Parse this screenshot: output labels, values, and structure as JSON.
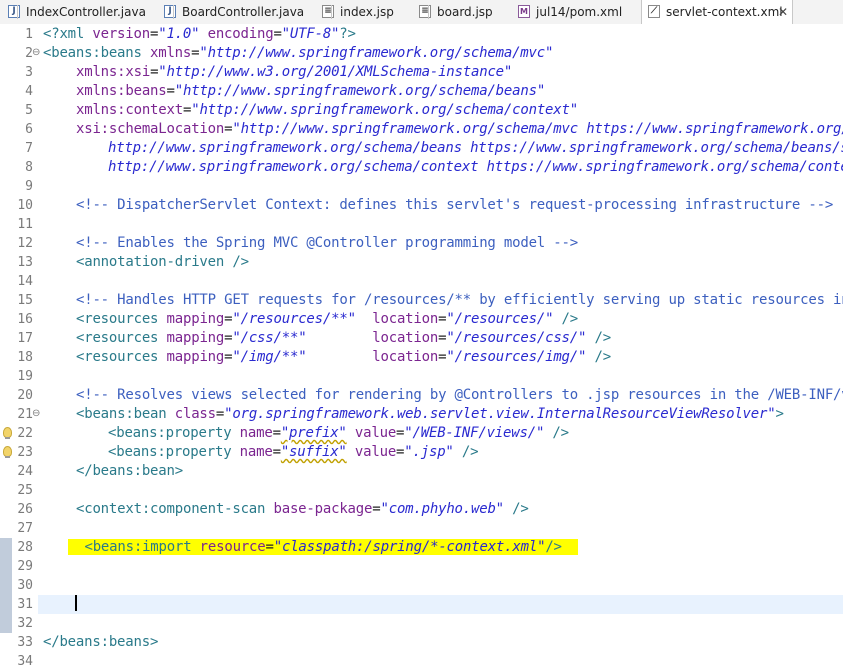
{
  "tabs": [
    {
      "label": "IndexController.java",
      "icon": "java-file-icon"
    },
    {
      "label": "BoardController.java",
      "icon": "java-file-icon"
    },
    {
      "label": "index.jsp",
      "icon": "jsp-file-icon"
    },
    {
      "label": "board.jsp",
      "icon": "jsp-file-icon"
    },
    {
      "label": "jul14/pom.xml",
      "icon": "maven-pom-icon"
    },
    {
      "label": "servlet-context.xml",
      "icon": "xml-file-icon",
      "active": true,
      "close": "✕"
    }
  ],
  "editor": {
    "line_numbers": [
      "1",
      "2",
      "3",
      "4",
      "5",
      "6",
      "7",
      "8",
      "9",
      "10",
      "11",
      "12",
      "13",
      "14",
      "15",
      "16",
      "17",
      "18",
      "19",
      "20",
      "21",
      "22",
      "23",
      "24",
      "25",
      "26",
      "27",
      "28",
      "29",
      "30",
      "31",
      "32",
      "33",
      "34"
    ],
    "text": {
      "l1": {
        "a": "<?xml ",
        "b": "version",
        "c": "=",
        "d": "\"1.0\"",
        "e": " encoding",
        "f": "=",
        "g": "\"UTF-8\"",
        "h": "?>"
      },
      "l2": {
        "a": "<beans:beans ",
        "b": "xmlns",
        "c": "=",
        "d": "\"http://www.springframework.org/schema/mvc\""
      },
      "l3": {
        "b": "xmlns:xsi",
        "c": "=",
        "d": "\"http://www.w3.org/2001/XMLSchema-instance\""
      },
      "l4": {
        "b": "xmlns:beans",
        "c": "=",
        "d": "\"http://www.springframework.org/schema/beans\""
      },
      "l5": {
        "b": "xmlns:context",
        "c": "=",
        "d": "\"http://www.springframework.org/schema/context\""
      },
      "l6": {
        "b": "xsi:schemaLocation",
        "c": "=",
        "d": "\"http://www.springframework.org/schema/mvc https://www.springframework.org/sc"
      },
      "l7": {
        "d": "http://www.springframework.org/schema/beans https://www.springframework.org/schema/beans/sp"
      },
      "l8": {
        "d": "http://www.springframework.org/schema/context https://www.springframework.org/schema/contex"
      },
      "l10": {
        "c": "<!-- DispatcherServlet Context: defines this servlet's request-processing infrastructure -->"
      },
      "l12": {
        "c": "<!-- Enables the Spring MVC @Controller programming model -->"
      },
      "l13": {
        "a": "<annotation-driven ",
        "h": "/>"
      },
      "l15": {
        "c": "<!-- Handles HTTP GET requests for /resources/** by efficiently serving up static resources in t"
      },
      "l16": {
        "a": "<resources ",
        "b": "mapping",
        "c": "=",
        "d": "\"/resources/**\"",
        "e": "  location",
        "f": "=",
        "g": "\"/resources/\"",
        "h": " />"
      },
      "l17": {
        "a": "<resources ",
        "b": "mapping",
        "c": "=",
        "d": "\"/css/**\"",
        "e": "        location",
        "f": "=",
        "g": "\"/resources/css/\"",
        "h": " />"
      },
      "l18": {
        "a": "<resources ",
        "b": "mapping",
        "c": "=",
        "d": "\"/img/**\"",
        "e": "        location",
        "f": "=",
        "g": "\"/resources/img/\"",
        "h": " />"
      },
      "l20": {
        "c": "<!-- Resolves views selected for rendering by @Controllers to .jsp resources in the /WEB-INF/vie"
      },
      "l21": {
        "a": "<beans:bean ",
        "b": "class",
        "c": "=",
        "d": "\"org.springframework.web.servlet.view.InternalResourceViewResolver\"",
        "h": ">"
      },
      "l22": {
        "a": "<beans:property ",
        "b": "name",
        "c": "=",
        "d": "\"prefix\"",
        "e": " value",
        "f": "=",
        "g": "\"/WEB-INF/views/\"",
        "h": " />"
      },
      "l23": {
        "a": "<beans:property ",
        "b": "name",
        "c": "=",
        "d": "\"suffix\"",
        "e": " value",
        "f": "=",
        "g": "\".jsp\"",
        "h": " />"
      },
      "l24": {
        "a": "</beans:bean>"
      },
      "l26": {
        "a": "<context:component-scan ",
        "b": "base-package",
        "c": "=",
        "d": "\"com.phyho.web\"",
        "h": " />"
      },
      "l28": {
        "a": "<beans:import ",
        "b": "resource",
        "c": "=",
        "d": "\"classpath:/spring/*-context.xml\"",
        "h": "/>"
      },
      "l33": {
        "a": "</beans:beans>"
      }
    }
  },
  "colors": {
    "tag": "#2a7a8a",
    "attr": "#7b2590",
    "value": "#2a2ad0",
    "comment": "#3c5fbf",
    "highlight": "#ffff00",
    "current_line": "#e8f2fe"
  }
}
